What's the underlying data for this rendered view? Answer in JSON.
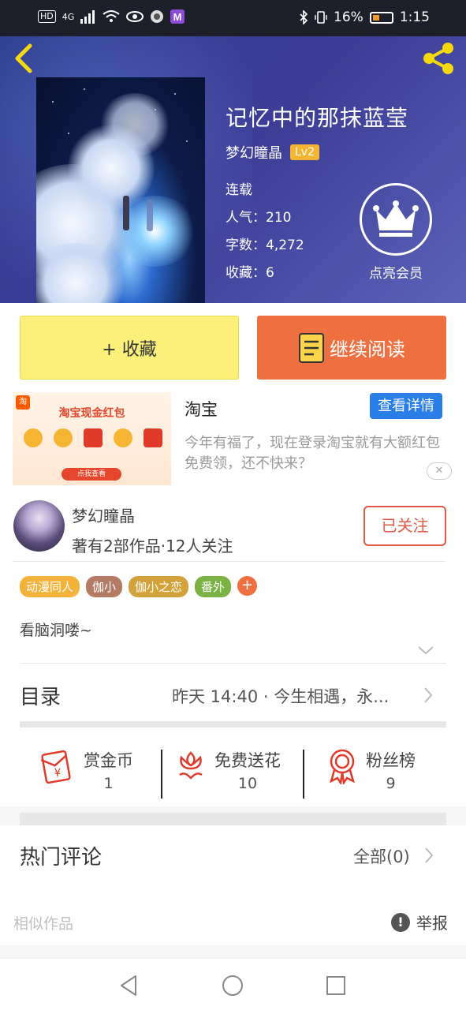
{
  "status_bar": {
    "network_badge": "HD",
    "network_type": "4G",
    "battery_percent": "16%",
    "time": "1:15"
  },
  "header": {
    "back_icon": "chevron-left-icon",
    "share_icon": "share-icon"
  },
  "book": {
    "title": "记忆中的那抹蓝莹",
    "author": "梦幻瞳晶",
    "level": "Lv2",
    "status": "连载",
    "popularity_label": "人气：",
    "popularity": "210",
    "words_label": "字数：",
    "words": "4,272",
    "favorites_label": "收藏：",
    "favorites": "6",
    "vip_label": "点亮会员"
  },
  "actions": {
    "collect_label": "+ 收藏",
    "read_label": "继续阅读"
  },
  "ad": {
    "image_title": "淘宝现金红包",
    "image_button": "点我查看",
    "logo_text": "淘",
    "title": "淘宝",
    "detail_button": "查看详情",
    "description": "今年有福了，现在登录淘宝就有大额红包免费领，还不快来？"
  },
  "author_card": {
    "name": "梦幻瞳晶",
    "summary": "著有2部作品·12人关注",
    "follow_label": "已关注",
    "tags": [
      {
        "label": "动漫同人",
        "color": "#f3b33a"
      },
      {
        "label": "伽小",
        "color": "#b47a64"
      },
      {
        "label": "伽小之恋",
        "color": "#d4a23b"
      },
      {
        "label": "番外",
        "color": "#7ab244"
      }
    ],
    "add_tag": "+",
    "intro": "看脑洞喽~"
  },
  "catalog": {
    "label": "目录",
    "latest": "昨天 14:40 · 今生相遇，永..."
  },
  "support": {
    "items": [
      {
        "label": "赏金币",
        "count": "1",
        "icon": "red-envelope-icon"
      },
      {
        "label": "免费送花",
        "count": "10",
        "icon": "flower-icon"
      },
      {
        "label": "粉丝榜",
        "count": "9",
        "icon": "medal-icon"
      }
    ],
    "accent": "#e03a2a"
  },
  "comments": {
    "title": "热门评论",
    "all_label": "全部(0)"
  },
  "footer": {
    "similar_label": "相似作品",
    "report_label": "举报",
    "report_icon_glyph": "!"
  },
  "colors": {
    "collect_bg": "#fbf07a",
    "read_bg": "#ee6f40",
    "follow": "#e05a45",
    "detail_bg": "#2a7ee8"
  }
}
